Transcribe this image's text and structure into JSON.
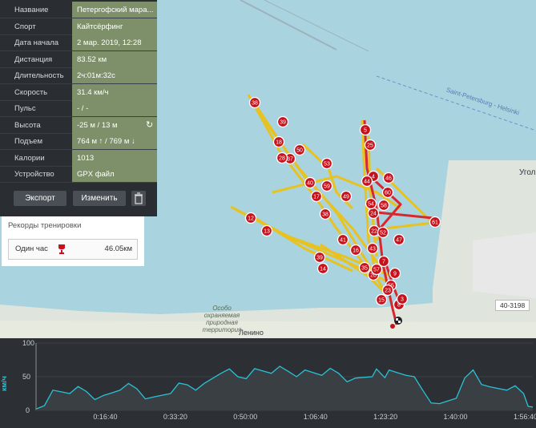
{
  "panel": {
    "rows": [
      {
        "key": "Название",
        "value": "Петергофский мара..."
      },
      {
        "key": "Спорт",
        "value": "Кайтсёрфинг"
      },
      {
        "key": "Дата начала",
        "value": "2 мар. 2019, 12:28"
      },
      {
        "key": "Дистанция",
        "value": "83.52 км"
      },
      {
        "key": "Длительность",
        "value": "2ч:01м:32с"
      },
      {
        "key": "Скорость",
        "value": "31.4 км/ч"
      },
      {
        "key": "Пульс",
        "value": "- / -"
      },
      {
        "key": "Высота",
        "value": "-25 м / 13 м"
      },
      {
        "key": "Подъем",
        "value": "764 м ↑ / 769 м ↓"
      },
      {
        "key": "Калории",
        "value": "1013"
      },
      {
        "key": "Устройство",
        "value": "GPX файл"
      }
    ],
    "export_label": "Экспорт",
    "edit_label": "Изменить"
  },
  "records": {
    "title": "Рекорды тренировки",
    "item_label": "Один час",
    "item_value": "46.05км"
  },
  "map": {
    "labels": [
      "Saint-Petersburg - Helsinki",
      "Угол",
      "Особо охраняемая природная территория",
      "Ленино"
    ],
    "road_badge": "40-3198",
    "markers": [
      "38",
      "39",
      "18",
      "50",
      "37",
      "28",
      "53",
      "40",
      "59",
      "17",
      "49",
      "38",
      "12",
      "13",
      "41",
      "16",
      "39",
      "14",
      "43",
      "20",
      "35",
      "57",
      "15",
      "8",
      "5",
      "25",
      "4",
      "46",
      "44",
      "60",
      "24",
      "58",
      "61",
      "47",
      "22",
      "52",
      "7",
      "9",
      "55",
      "23",
      "54",
      "3"
    ],
    "colors": {
      "water": "#a9d3df",
      "land": "#dfe5dc",
      "track": "#e8c21e",
      "track_fast": "#d8282e",
      "marker": "#c6121d"
    }
  },
  "chart_data": {
    "type": "area",
    "ylabel": "км/ч",
    "yticks": [
      "100",
      "50",
      "0"
    ],
    "ylim": [
      0,
      100
    ],
    "xticks": [
      "0:16:40",
      "0:33:20",
      "0:50:00",
      "1:06:40",
      "1:23:20",
      "1:40:00",
      "1:56:40"
    ],
    "x_seconds": [
      0,
      240,
      480,
      720,
      960,
      1200,
      1440,
      1680,
      1920,
      2160,
      2400,
      2640,
      2880,
      3120,
      3360,
      3600,
      3840,
      4080,
      4320,
      4560,
      4800,
      4920,
      5040,
      5280,
      5520,
      5760,
      6000,
      6240,
      6480,
      6720,
      6960,
      7092
    ],
    "values": [
      2,
      30,
      25,
      28,
      22,
      30,
      32,
      20,
      25,
      38,
      40,
      55,
      50,
      62,
      55,
      58,
      60,
      52,
      55,
      48,
      50,
      55,
      60,
      52,
      30,
      10,
      18,
      60,
      35,
      30,
      25,
      5
    ],
    "colors": {
      "line": "#29c2d6",
      "fill": "#3a3f44",
      "bg": "#2c3034"
    }
  }
}
